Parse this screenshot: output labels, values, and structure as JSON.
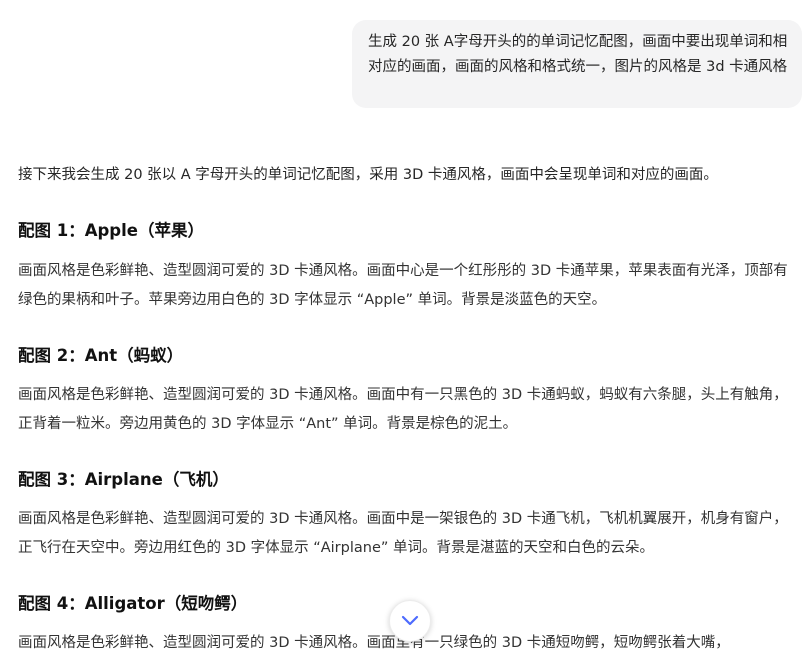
{
  "user_message": {
    "text": "生成 20 张 A字母开头的的单词记忆配图，画面中要出现单词和相对应的画面，画面的风格和格式统一，图片的风格是 3d 卡通风格"
  },
  "assistant": {
    "intro": "接下来我会生成 20 张以 A 字母开头的单词记忆配图，采用 3D 卡通风格，画面中会呈现单词和对应的画面。",
    "sections": [
      {
        "title": "配图 1：Apple（苹果）",
        "description": "画面风格是色彩鲜艳、造型圆润可爱的 3D 卡通风格。画面中心是一个红彤彤的 3D 卡通苹果，苹果表面有光泽，顶部有绿色的果柄和叶子。苹果旁边用白色的 3D 字体显示 “Apple” 单词。背景是淡蓝色的天空。"
      },
      {
        "title": "配图 2：Ant（蚂蚁）",
        "description": "画面风格是色彩鲜艳、造型圆润可爱的 3D 卡通风格。画面中有一只黑色的 3D 卡通蚂蚁，蚂蚁有六条腿，头上有触角，正背着一粒米。旁边用黄色的 3D 字体显示 “Ant” 单词。背景是棕色的泥土。"
      },
      {
        "title": "配图 3：Airplane（飞机）",
        "description": "画面风格是色彩鲜艳、造型圆润可爱的 3D 卡通风格。画面中是一架银色的 3D 卡通飞机，飞机机翼展开，机身有窗户，正飞行在天空中。旁边用红色的 3D 字体显示 “Airplane” 单词。背景是湛蓝的天空和白色的云朵。"
      },
      {
        "title": "配图 4：Alligator（短吻鳄）",
        "description": "画面风格是色彩鲜艳、造型圆润可爱的 3D 卡通风格。画面里有一只绿色的 3D 卡通短吻鳄，短吻鳄张着大嘴，"
      }
    ]
  },
  "controls": {
    "scroll_down_icon": "chevron-down-icon",
    "accent_color": "#4d6bfe"
  }
}
